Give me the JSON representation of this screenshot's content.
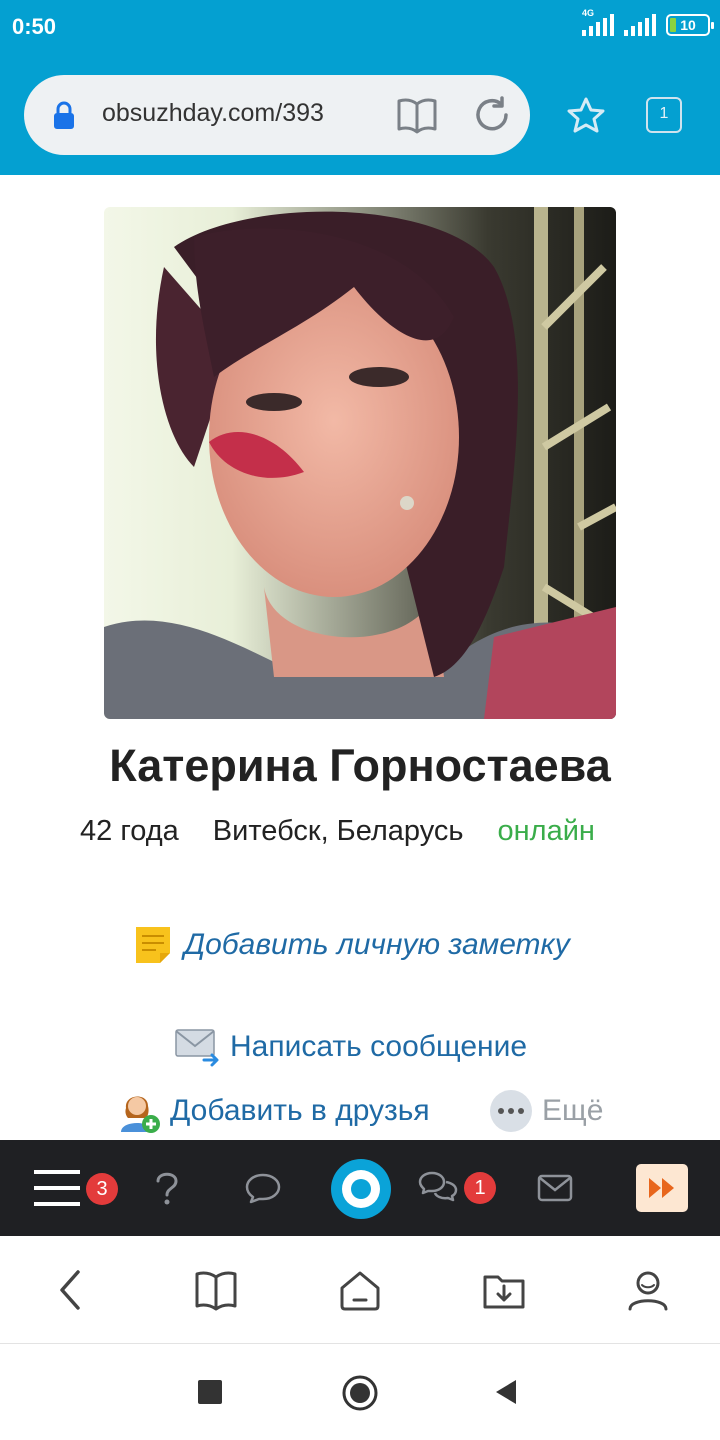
{
  "status": {
    "time": "0:50",
    "network": "4G",
    "battery": "10"
  },
  "browser": {
    "url": "obsuzhday.com/393",
    "tab_count": "1"
  },
  "profile": {
    "name": "Катерина Горностаева",
    "age": "42 года",
    "location": "Витебск, Беларусь",
    "status": "онлайн"
  },
  "actions": {
    "add_note": "Добавить личную заметку",
    "write_message": "Написать сообщение",
    "add_friend": "Добавить в друзья",
    "more": "Ещё"
  },
  "sitebar": {
    "menu_badge": "3",
    "chat_badge": "1"
  },
  "colors": {
    "accent": "#04a0d1",
    "link": "#1f6aa5",
    "online": "#3aad4a",
    "badge": "#e33b3b"
  }
}
